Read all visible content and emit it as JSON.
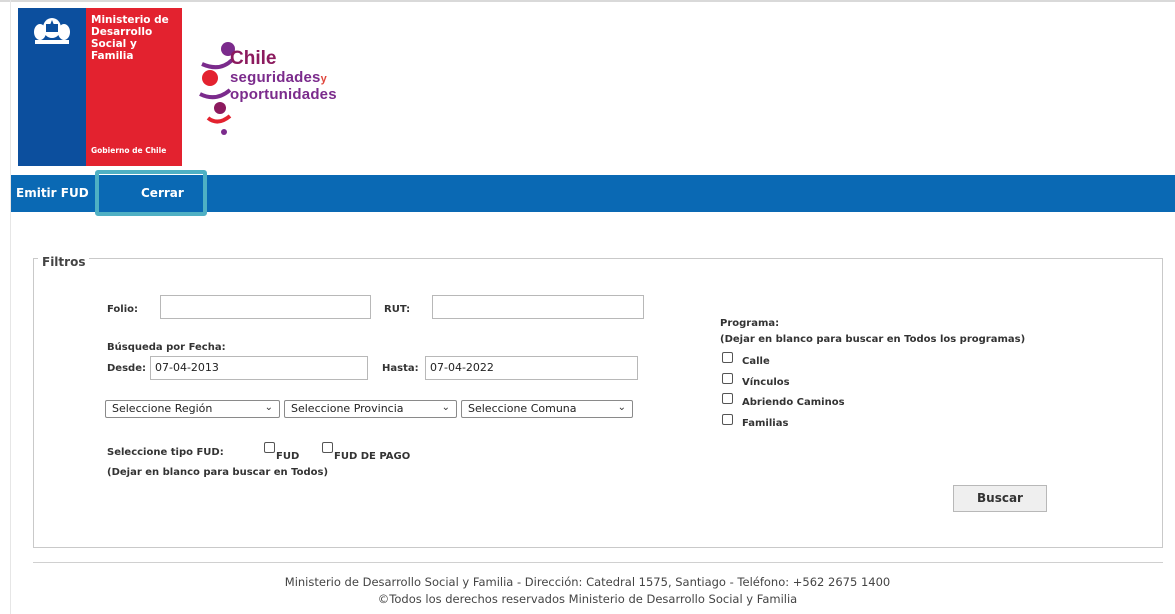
{
  "header": {
    "gov_logo": {
      "ministry": [
        "Ministerio de",
        "Desarrollo",
        "Social y",
        "Familia"
      ],
      "government": "Gobierno de Chile",
      "colors": {
        "blue": "#0c4f9e",
        "red": "#e3222f"
      }
    },
    "program_logo": {
      "chile": "Chile",
      "line1": "seguridades",
      "line1_suffix": "y",
      "line2": "oportunidades"
    }
  },
  "nav": {
    "items": [
      "Emitir FUD",
      "Cerrar"
    ],
    "color": "#0a69b4",
    "highlight_color": "#4fb0c4"
  },
  "filters": {
    "legend": "Filtros",
    "folio_label": "Folio:",
    "folio_value": "",
    "rut_label": "RUT:",
    "rut_value": "",
    "date_search_label": "Búsqueda por Fecha:",
    "from_label": "Desde:",
    "from_value": "07-04-2013",
    "to_label": "Hasta:",
    "to_value": "07-04-2022",
    "region_select": "Seleccione Región",
    "province_select": "Seleccione Provincia",
    "commune_select": "Seleccione Comuna",
    "fud_type_label": "Seleccione tipo FUD:",
    "fud_types": [
      "FUD",
      "FUD DE PAGO"
    ],
    "fud_type_hint": "(Dejar en blanco para buscar en Todos)",
    "program_label": "Programa:",
    "program_hint": "(Dejar en blanco para buscar en Todos los programas)",
    "programs": [
      "Calle",
      "Vínculos",
      "Abriendo Caminos",
      "Familias"
    ],
    "search_button": "Buscar"
  },
  "footer": {
    "line1": "Ministerio de Desarrollo Social y Familia - Dirección: Catedral 1575, Santiago - Teléfono: +562 2675 1400",
    "line2": "©Todos los derechos reservados Ministerio de Desarrollo Social y Familia"
  }
}
